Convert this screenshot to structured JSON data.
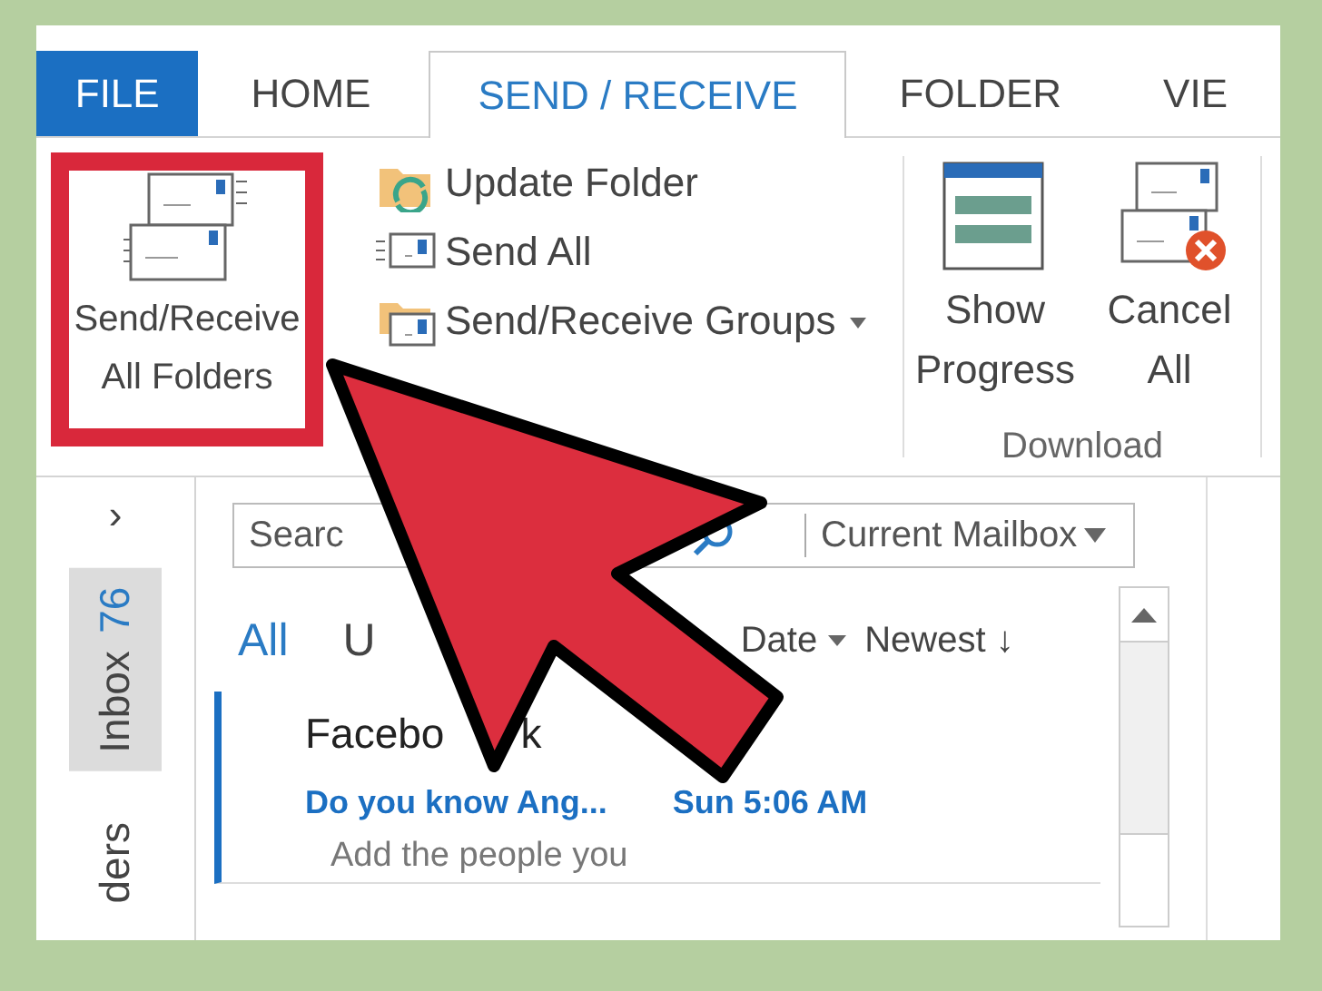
{
  "tabs": [
    {
      "label": "FILE",
      "kind": "file",
      "selected": false
    },
    {
      "label": "HOME",
      "kind": "tab",
      "selected": false
    },
    {
      "label": "SEND / RECEIVE",
      "kind": "tab",
      "selected": true
    },
    {
      "label": "FOLDER",
      "kind": "tab",
      "selected": false
    },
    {
      "label": "VIE",
      "kind": "tab",
      "selected": false
    }
  ],
  "ribbon": {
    "large_button": {
      "label_lines": [
        "Send/Receive",
        "All Folders"
      ],
      "highlighted": true
    },
    "small_buttons": [
      {
        "label": "Update Folder",
        "dropdown": false
      },
      {
        "label": "Send All",
        "dropdown": false
      },
      {
        "label": "Send/Receive Groups",
        "dropdown": true
      }
    ],
    "download_group": {
      "label": "Download",
      "buttons": [
        {
          "label_lines": [
            "Show",
            "Progress"
          ]
        },
        {
          "label_lines": [
            "Cancel",
            "All"
          ]
        }
      ]
    }
  },
  "nav": {
    "expand": "›",
    "tabs": [
      {
        "label": "Inbox",
        "count": "76",
        "selected": true
      },
      {
        "label": "ders",
        "selected": false
      }
    ]
  },
  "mail": {
    "search": {
      "placeholder": "Searc",
      "scope": "Current Mailbox"
    },
    "filters": [
      {
        "label": "All",
        "selected": true
      },
      {
        "label": "U",
        "selected": false
      }
    ],
    "sort": {
      "field": "Date",
      "order": "Newest ↓"
    },
    "messages": [
      {
        "sender_parts": [
          "Facebo",
          "k"
        ],
        "subject": "Do you know Ang...",
        "time": "Sun 5:06 AM",
        "preview": "Add the people you",
        "unread": true
      }
    ]
  }
}
